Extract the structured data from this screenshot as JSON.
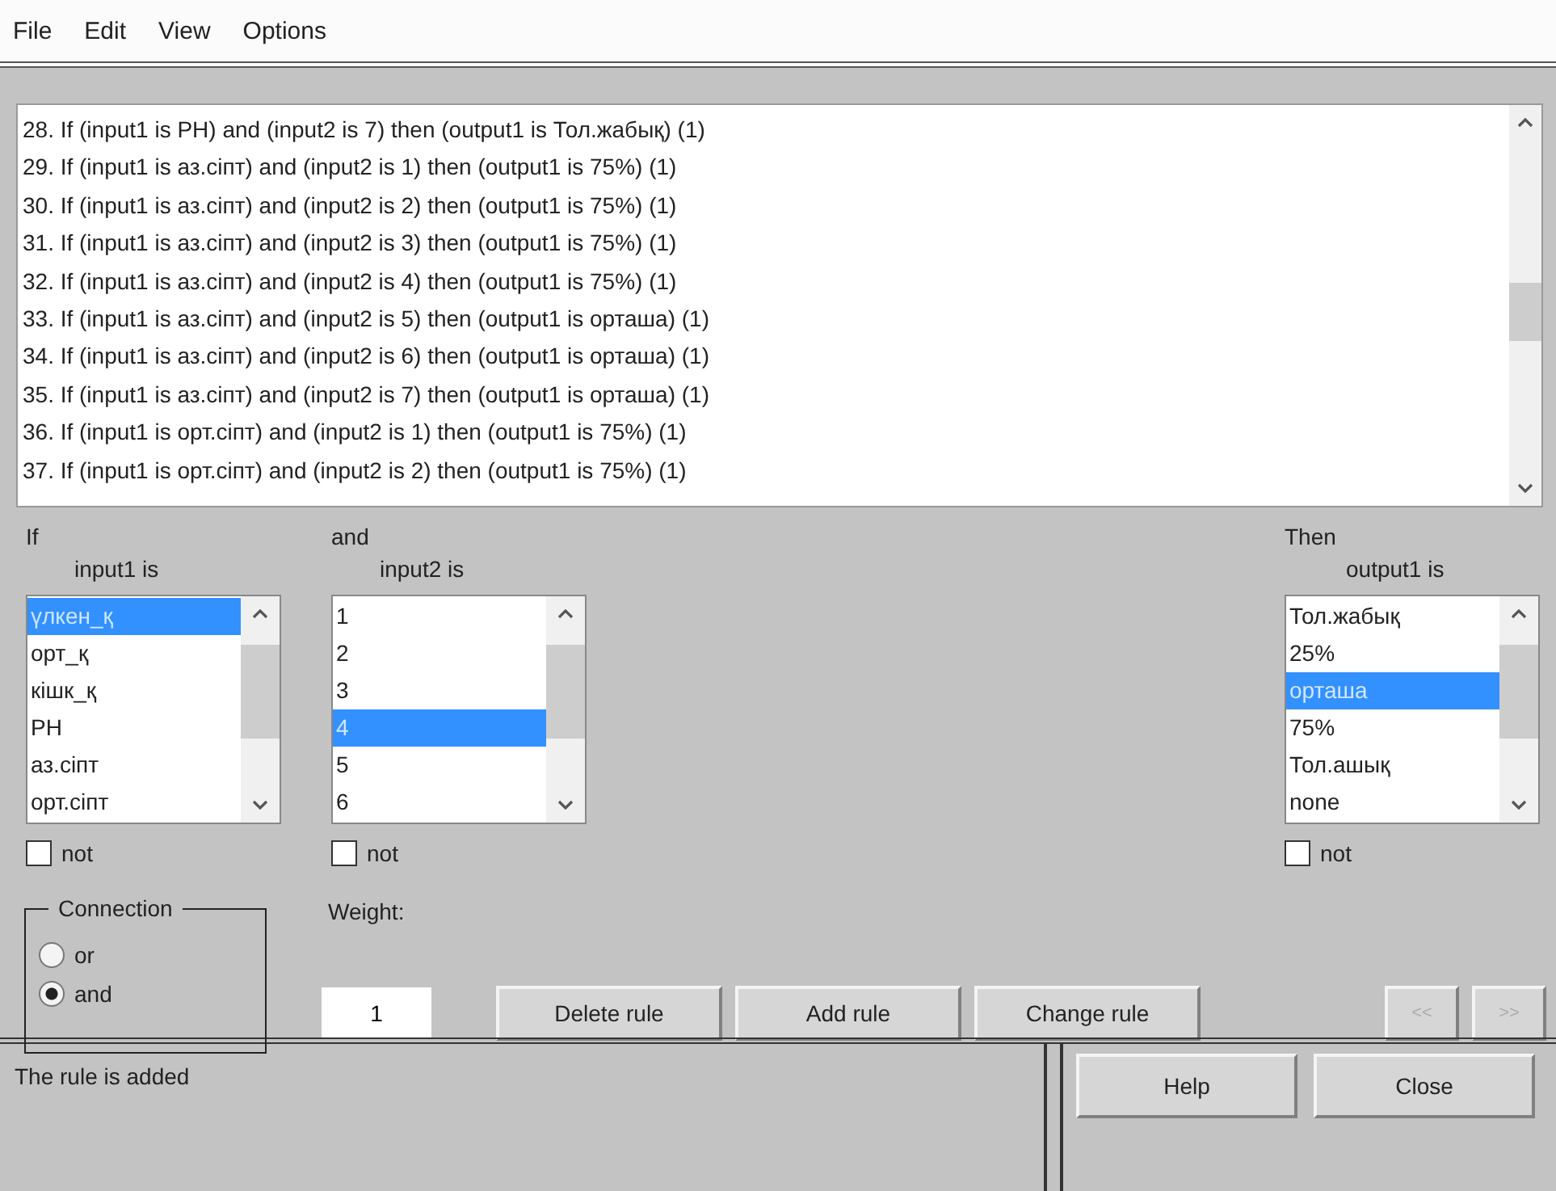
{
  "menu": [
    "File",
    "Edit",
    "View",
    "Options"
  ],
  "rules": [
    "28. If (input1 is PH) and (input2 is 7) then (output1 is Тол.жабық) (1)",
    "29. If (input1 is аз.сіпт) and (input2 is 1) then (output1 is 75%) (1)",
    "30. If (input1 is аз.сіпт) and (input2 is 2) then (output1 is 75%) (1)",
    "31. If (input1 is аз.сіпт) and (input2 is 3) then (output1 is 75%) (1)",
    "32. If (input1 is аз.сіпт) and (input2 is 4) then (output1 is 75%) (1)",
    "33. If (input1 is аз.сіпт) and (input2 is 5) then (output1 is орташа) (1)",
    "34. If (input1 is аз.сіпт) and (input2 is 6) then (output1 is орташа) (1)",
    "35. If (input1 is аз.сіпт) and (input2 is 7) then (output1 is орташа) (1)",
    "36. If (input1 is орт.сіпт) and (input2 is 1) then (output1 is 75%) (1)",
    "37. If (input1 is орт.сіпт) and (input2 is 2) then (output1 is 75%) (1)"
  ],
  "antecedents": [
    {
      "header": "If",
      "label": "input1 is",
      "items": [
        {
          "label": "үлкен_қ",
          "selected": true
        },
        {
          "label": "орт_қ",
          "selected": false
        },
        {
          "label": "кішк_қ",
          "selected": false
        },
        {
          "label": "PH",
          "selected": false
        },
        {
          "label": "аз.сіпт",
          "selected": false
        },
        {
          "label": "орт.сіпт",
          "selected": false
        }
      ],
      "not": {
        "label": "not",
        "checked": false
      }
    },
    {
      "header": "and",
      "label": "input2 is",
      "items": [
        {
          "label": "1",
          "selected": false
        },
        {
          "label": "2",
          "selected": false
        },
        {
          "label": "3",
          "selected": false
        },
        {
          "label": "4",
          "selected": true
        },
        {
          "label": "5",
          "selected": false
        },
        {
          "label": "6",
          "selected": false
        }
      ],
      "not": {
        "label": "not",
        "checked": false
      }
    }
  ],
  "consequent": {
    "header": "Then",
    "label": "output1 is",
    "items": [
      {
        "label": "Тол.жабық",
        "selected": false
      },
      {
        "label": "25%",
        "selected": false
      },
      {
        "label": "орташа",
        "selected": true
      },
      {
        "label": "75%",
        "selected": false
      },
      {
        "label": "Тол.ашық",
        "selected": false
      },
      {
        "label": "none",
        "selected": false
      }
    ],
    "not": {
      "label": "not",
      "checked": false
    }
  },
  "connection": {
    "title": "Connection",
    "options": [
      {
        "label": "or",
        "selected": false
      },
      {
        "label": "and",
        "selected": true
      }
    ]
  },
  "weight": {
    "label": "Weight:",
    "value": "1"
  },
  "buttons": [
    {
      "label": "Delete rule",
      "disabled": false
    },
    {
      "label": "Add rule",
      "disabled": false
    },
    {
      "label": "Change rule",
      "disabled": false
    }
  ],
  "nav_buttons": [
    {
      "label": "<<",
      "disabled": true
    },
    {
      "label": ">>",
      "disabled": true
    }
  ],
  "status": "The rule is added",
  "footer_buttons": [
    "Help",
    "Close"
  ]
}
